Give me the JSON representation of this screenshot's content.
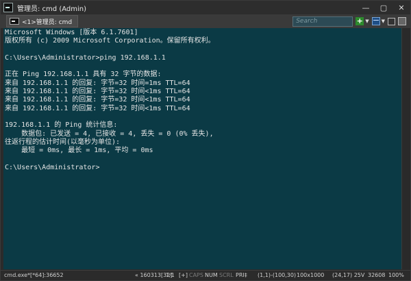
{
  "window": {
    "title": "管理员: cmd (Admin)",
    "controls": {
      "minimize": "—",
      "maximize": "▢",
      "close": "✕"
    }
  },
  "tabbar": {
    "tab_label": "<1>管理员: cmd",
    "search_placeholder": "Search",
    "add_symbol": "+"
  },
  "console": {
    "lines": [
      "Microsoft Windows [版本 6.1.7601]",
      "版权所有 (c) 2009 Microsoft Corporation。保留所有权利。",
      "",
      "C:\\Users\\Administrator>ping 192.168.1.1",
      "",
      "正在 Ping 192.168.1.1 具有 32 字节的数据:",
      "来自 192.168.1.1 的回复: 字节=32 时间=1ms TTL=64",
      "来自 192.168.1.1 的回复: 字节=32 时间<1ms TTL=64",
      "来自 192.168.1.1 的回复: 字节=32 时间<1ms TTL=64",
      "来自 192.168.1.1 的回复: 字节=32 时间<1ms TTL=64",
      "",
      "192.168.1.1 的 Ping 统计信息:",
      "    数据包: 已发送 = 4, 已接收 = 4, 丢失 = 0 (0% 丢失),",
      "往返行程的估计时间(以毫秒为单位):",
      "    最短 = 0ms, 最长 = 1ms, 平均 = 0ms",
      "",
      "C:\\Users\\Administrator>"
    ]
  },
  "statusbar": {
    "process": "cmd.exe*[*64]:36652",
    "build": "« 160313[32]",
    "console_index": "1/1",
    "plus": "[+]",
    "caps": "CAPS",
    "num": "NUM",
    "scrl": "SCRL",
    "pri": "PRI‡",
    "cursor": "(1,1)-(100,30)",
    "size": "100x1000",
    "pos": "(24,17) 25V",
    "buffer": "32608",
    "zoom": "100%"
  }
}
